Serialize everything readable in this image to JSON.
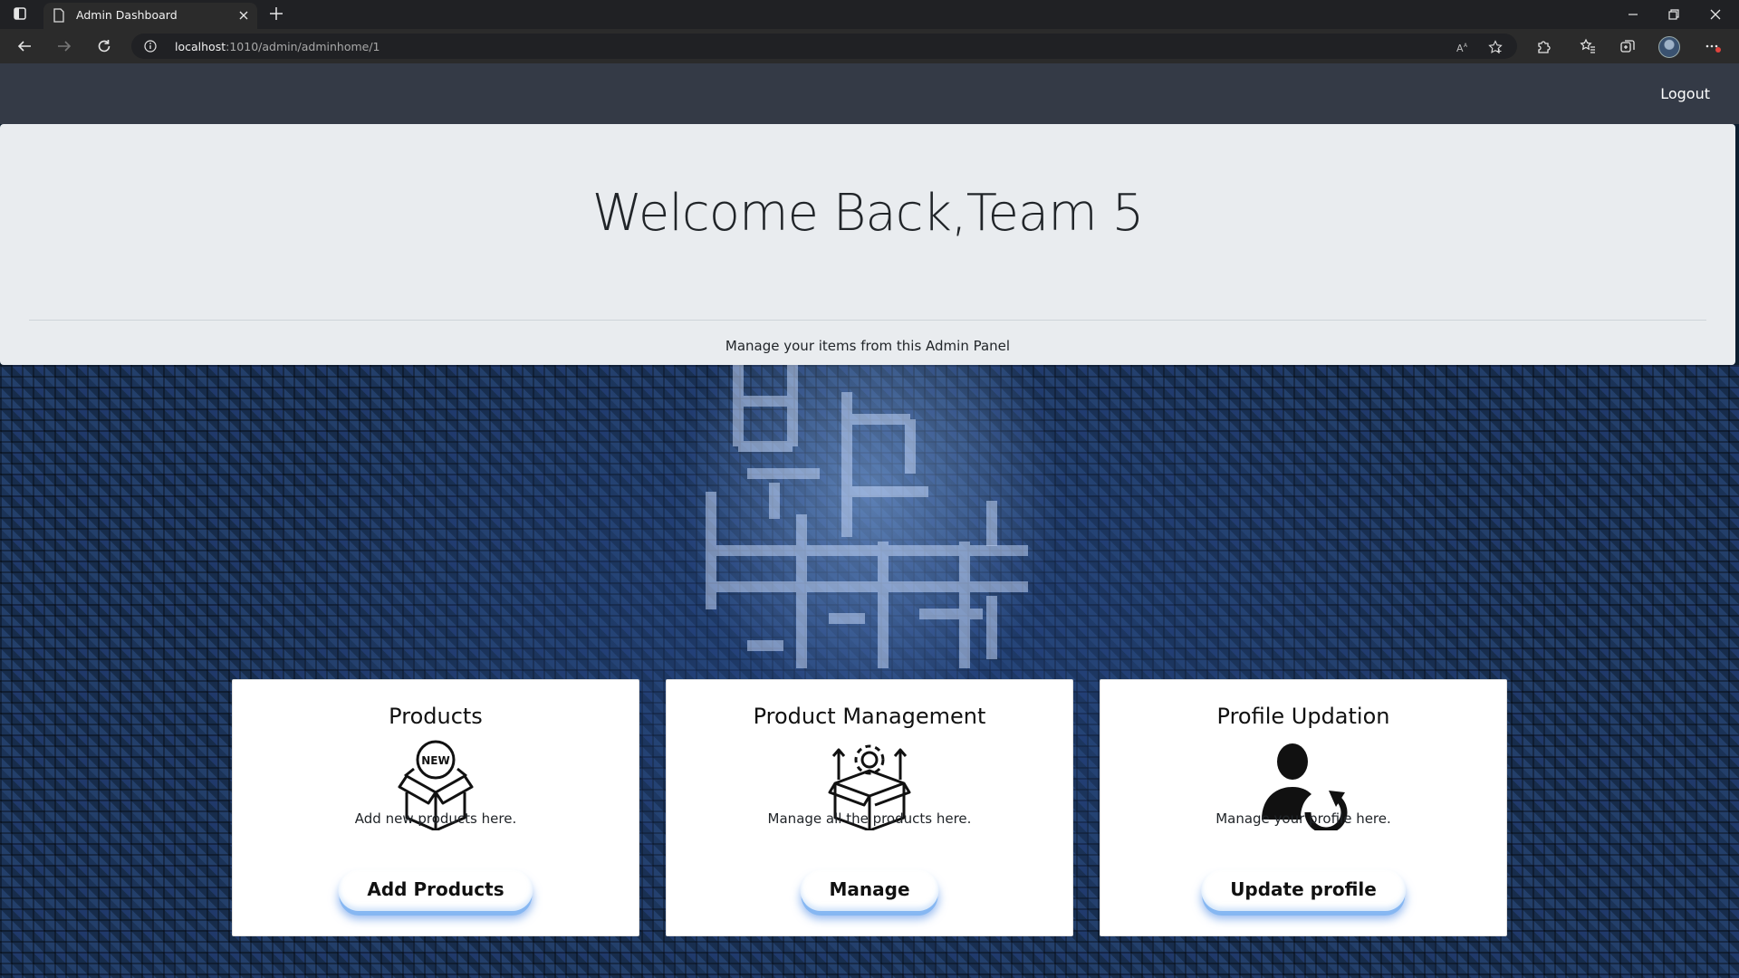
{
  "browser": {
    "tab_title": "Admin Dashboard",
    "url_host": "localhost",
    "url_rest": ":1010/admin/adminhome/1",
    "icons": [
      "sidebar-icon",
      "page-icon",
      "close-icon",
      "new-tab-icon",
      "minimize-icon",
      "restore-icon",
      "close-window-icon",
      "back-icon",
      "forward-icon",
      "reload-icon",
      "info-icon",
      "read-aloud-icon",
      "add-favorite-icon",
      "extensions-icon",
      "favorites-icon",
      "collections-icon",
      "profile-avatar",
      "more-icon"
    ]
  },
  "navbar": {
    "logout_label": "Logout"
  },
  "jumbotron": {
    "title": "Welcome Back,Team 5",
    "subtitle": "Manage your items from this Admin Panel"
  },
  "cards": [
    {
      "title": "Products",
      "icon": "new-box-icon",
      "description": "Add new products here.",
      "button_label": "Add Products"
    },
    {
      "title": "Product Management",
      "icon": "box-gear-icon",
      "description": "Manage all the products here.",
      "button_label": "Manage"
    },
    {
      "title": "Profile Updation",
      "icon": "user-refresh-icon",
      "description": "Manage your profile here.",
      "button_label": "Update profile"
    }
  ],
  "colors": {
    "navbar_bg": "#343a46",
    "jumbotron_bg": "#e9ecef",
    "button_glow": "#86b7f2",
    "hero_bg": "#10223a"
  }
}
